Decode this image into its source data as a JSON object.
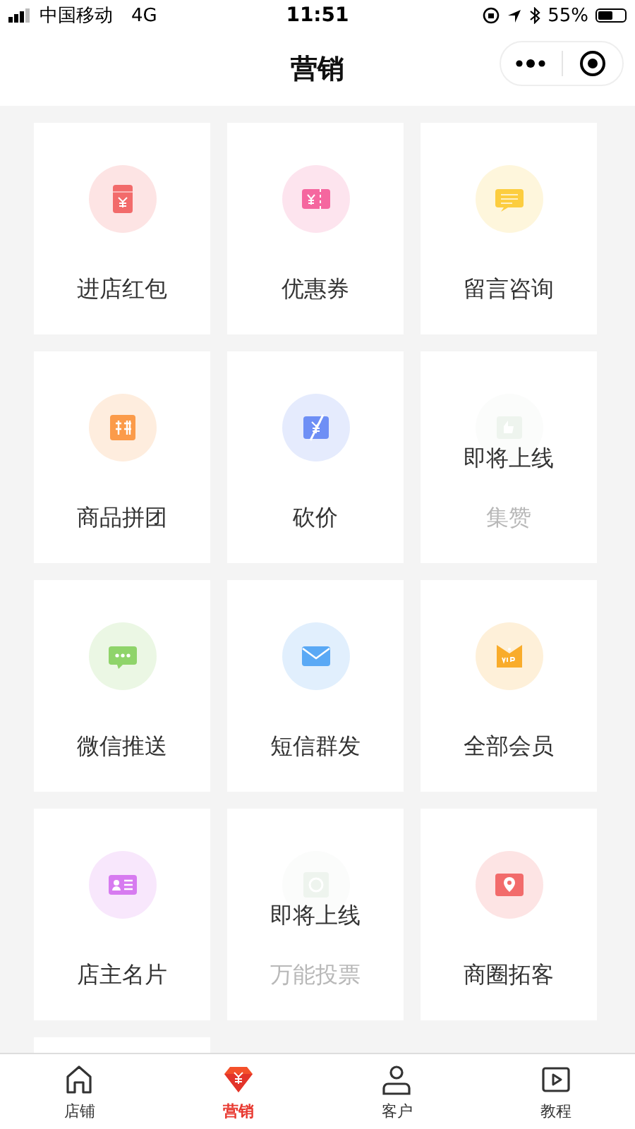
{
  "status_bar": {
    "carrier": "中国移动",
    "network": "4G",
    "time": "11:51",
    "battery": "55%"
  },
  "nav": {
    "title": "营销"
  },
  "items": [
    {
      "label": "进店红包",
      "color": "#f26b6b",
      "coming_soon": false
    },
    {
      "label": "优惠券",
      "color": "#f5679f",
      "coming_soon": false
    },
    {
      "label": "留言咨询",
      "color": "#fccd3f",
      "coming_soon": false
    },
    {
      "label": "商品拼团",
      "color": "#fb9b4a",
      "coming_soon": false
    },
    {
      "label": "砍价",
      "color": "#6e8ff5",
      "coming_soon": false
    },
    {
      "label": "集赞",
      "coming_soon": true,
      "notice": "即将上线"
    },
    {
      "label": "微信推送",
      "color": "#8fd46a",
      "coming_soon": false
    },
    {
      "label": "短信群发",
      "color": "#5aa9f5",
      "coming_soon": false
    },
    {
      "label": "全部会员",
      "color": "#f9ac2b",
      "coming_soon": false
    },
    {
      "label": "店主名片",
      "color": "#d77bf0",
      "coming_soon": false
    },
    {
      "label": "万能投票",
      "coming_soon": true,
      "notice": "即将上线"
    },
    {
      "label": "商圈拓客",
      "color": "#f26b6b",
      "coming_soon": false
    }
  ],
  "tabs": [
    {
      "label": "店铺",
      "selected": false
    },
    {
      "label": "营销",
      "selected": true
    },
    {
      "label": "客户",
      "selected": false
    },
    {
      "label": "教程",
      "selected": false
    }
  ]
}
